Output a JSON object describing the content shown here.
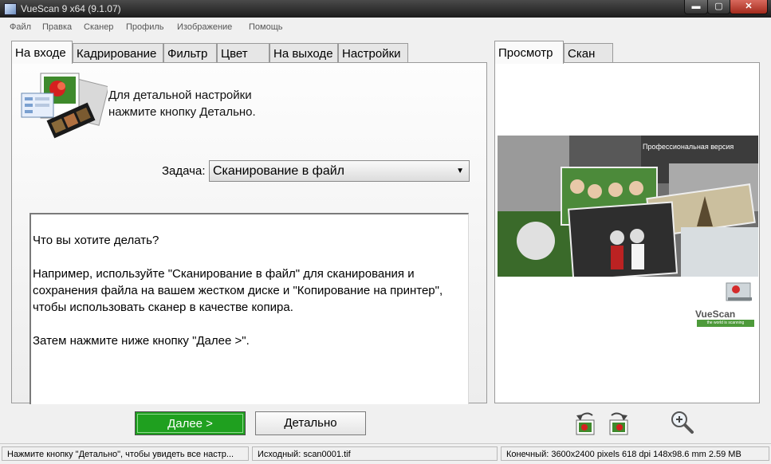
{
  "window": {
    "title": "VueScan 9 x64 (9.1.07)",
    "min_label": "▬",
    "max_label": "▢",
    "close_label": "✕"
  },
  "menu": [
    "Файл",
    "Правка",
    "Сканер",
    "Профиль",
    "Изображение",
    "Помощь"
  ],
  "left_tabs": [
    "На входе",
    "Кадрирование",
    "Фильтр",
    "Цвет",
    "На выходе",
    "Настройки"
  ],
  "active_left_tab": "На входе",
  "hint": {
    "line1": "Для детальной настройки",
    "line2": "нажмите кнопку Детально."
  },
  "task": {
    "label": "Задача:",
    "value": "Сканирование в файл"
  },
  "info": {
    "p1": "Что вы хотите делать?",
    "p2": "Например, используйте \"Сканирование в файл\" для сканирования и сохранения файла на вашем жестком диске и \"Копирование на принтер\", чтобы использовать сканер в качестве копира.",
    "p3": "Затем нажмите ниже кнопку \"Далее >\"."
  },
  "right_tabs": [
    "Просмотр",
    "Скан"
  ],
  "active_right_tab": "Просмотр",
  "banner": {
    "edition": "Профессиональная версия"
  },
  "logo": {
    "name": "VueScan",
    "slogan": "the world is scanning"
  },
  "buttons": {
    "next": "Далее >",
    "detail": "Детально"
  },
  "status": {
    "hint": "Нажмите кнопку \"Детально\", чтобы увидеть все настр...",
    "source": "Исходный: scan0001.tif",
    "output": "Конечный: 3600x2400 pixels 618 dpi 148x98.6 mm 2.59 MB"
  },
  "colors": {
    "next_button": "#1fa01f",
    "titlebar": "#2a2a2a"
  }
}
